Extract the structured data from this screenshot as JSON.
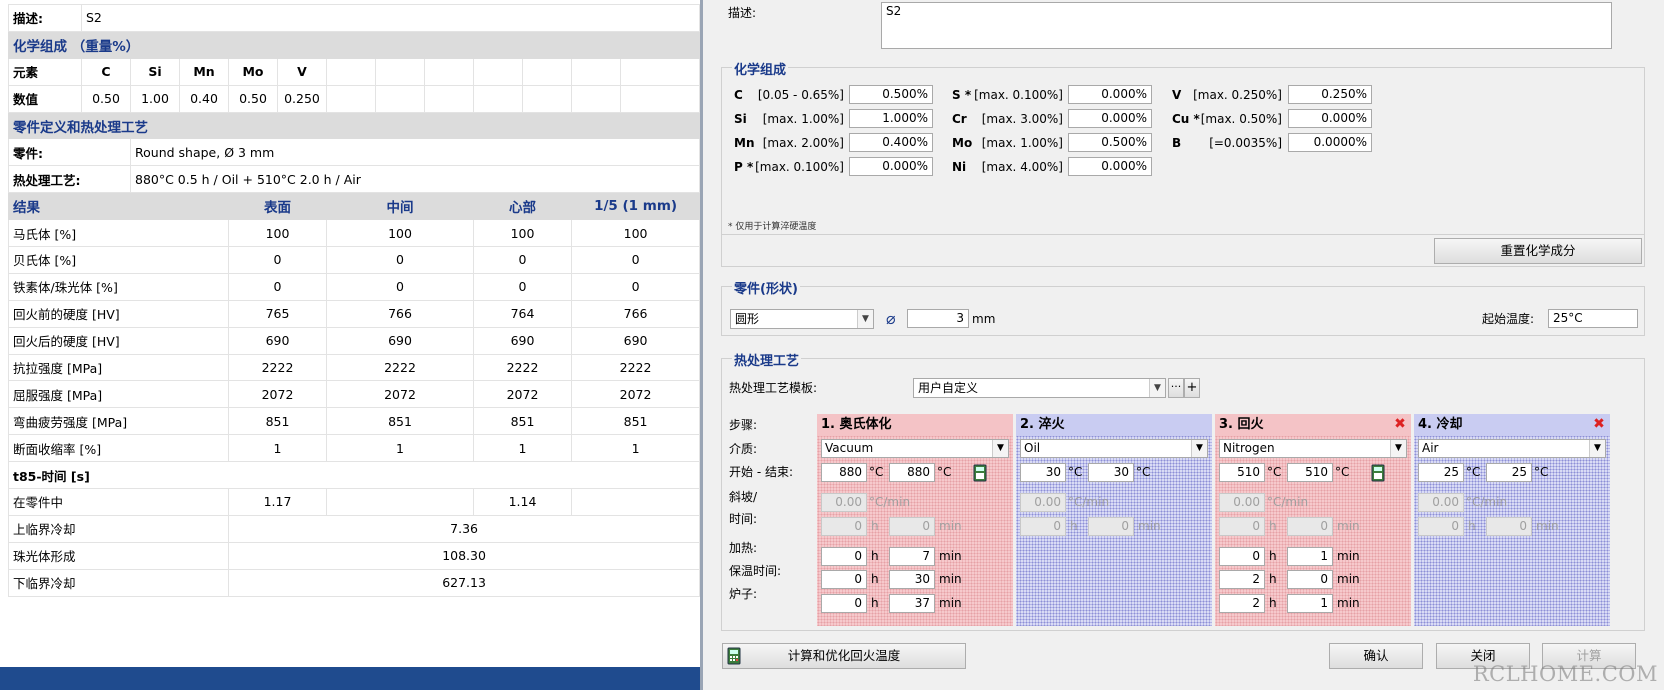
{
  "report": {
    "desc_label": "描述:",
    "desc_value": "S2",
    "chem_title": "化学组成 （重量%）",
    "element_label": "元素",
    "value_label": "数值",
    "elements": [
      "C",
      "Si",
      "Mn",
      "Mo",
      "V"
    ],
    "element_values": [
      "0.50",
      "1.00",
      "0.40",
      "0.50",
      "0.250"
    ],
    "part_title": "零件定义和热处理工艺",
    "part_label": "零件:",
    "part_value": "Round shape, Ø 3 mm",
    "ht_label": "热处理工艺:",
    "ht_value": "880°C 0.5 h / Oil + 510°C 2.0 h / Air",
    "results_header": [
      "结果",
      "表面",
      "中间",
      "心部",
      "1/5 (1 mm)"
    ],
    "results": [
      {
        "label": "马氏体 [%]",
        "values": [
          "100",
          "100",
          "100",
          "100"
        ]
      },
      {
        "label": "贝氏体 [%]",
        "values": [
          "0",
          "0",
          "0",
          "0"
        ]
      },
      {
        "label": "铁素体/珠光体 [%]",
        "values": [
          "0",
          "0",
          "0",
          "0"
        ]
      },
      {
        "label": "回火前的硬度 [HV]",
        "values": [
          "765",
          "766",
          "764",
          "766"
        ]
      },
      {
        "label": "回火后的硬度 [HV]",
        "values": [
          "690",
          "690",
          "690",
          "690"
        ]
      },
      {
        "label": "抗拉强度 [MPa]",
        "values": [
          "2222",
          "2222",
          "2222",
          "2222"
        ]
      },
      {
        "label": "屈服强度 [MPa]",
        "values": [
          "2072",
          "2072",
          "2072",
          "2072"
        ]
      },
      {
        "label": "弯曲疲劳强度 [MPa]",
        "values": [
          "851",
          "851",
          "851",
          "851"
        ]
      },
      {
        "label": "断面收缩率 [%]",
        "values": [
          "1",
          "1",
          "1",
          "1"
        ]
      }
    ],
    "t85_label": "t85-时间 [s]",
    "in_part_label": "在零件中",
    "in_part_values": [
      "1.17",
      "1.14"
    ],
    "upper_label": "上临界冷却",
    "upper_value": "7.36",
    "pearlite_label": "珠光体形成",
    "pearlite_value": "108.30",
    "lower_label": "下临界冷却",
    "lower_value": "627.13"
  },
  "dialog": {
    "desc_label": "描述:",
    "desc_value": "S2",
    "chem_title": "化学组成",
    "chem": [
      {
        "el": "C",
        "range": "[0.05 - 0.65%]",
        "value": "0.500%"
      },
      {
        "el": "Si",
        "range": "[max. 1.00%]",
        "value": "1.000%"
      },
      {
        "el": "Mn",
        "range": "[max. 2.00%]",
        "value": "0.400%"
      },
      {
        "el": "P *",
        "range": "[max. 0.100%]",
        "value": "0.000%"
      },
      {
        "el": "S *",
        "range": "[max. 0.100%]",
        "value": "0.000%"
      },
      {
        "el": "Cr",
        "range": "[max. 3.00%]",
        "value": "0.000%"
      },
      {
        "el": "Mo",
        "range": "[max. 1.00%]",
        "value": "0.500%"
      },
      {
        "el": "Ni",
        "range": "[max. 4.00%]",
        "value": "0.000%"
      },
      {
        "el": "V",
        "range": "[max. 0.250%]",
        "value": "0.250%"
      },
      {
        "el": "Cu *",
        "range": "[max. 0.50%]",
        "value": "0.000%"
      },
      {
        "el": "B",
        "range": "[=0.0035%]",
        "value": "0.0000%"
      }
    ],
    "footnote": "* 仅用于计算淬硬温度",
    "reset_button": "重置化学成分",
    "part_title": "零件(形状)",
    "shape": "圆形",
    "diameter": "3",
    "diameter_unit": "mm",
    "start_temp_label": "起始温度:",
    "start_temp": "25°C",
    "ht_title": "热处理工艺",
    "template_label": "热处理工艺模板:",
    "template_value": "用户自定义",
    "row_labels": [
      "步骤:",
      "介质:",
      "开始 - 结束:",
      "斜坡/",
      "时间:",
      "加热:",
      "保温时间:",
      "炉子:"
    ],
    "stages": [
      {
        "title": "1. 奥氏体化",
        "medium": "Vacuum",
        "start": "880",
        "end": "880",
        "ramp": "0.00",
        "rh": "0",
        "rm": "0",
        "heat_h": "0",
        "heat_m": "7",
        "hold_h": "0",
        "hold_m": "30",
        "furn_h": "0",
        "furn_m": "37"
      },
      {
        "title": "2. 淬火",
        "medium": "Oil",
        "start": "30",
        "end": "30",
        "ramp": "0.00",
        "rh": "0",
        "rm": "0"
      },
      {
        "title": "3. 回火",
        "medium": "Nitrogen",
        "start": "510",
        "end": "510",
        "ramp": "0.00",
        "rh": "0",
        "rm": "0",
        "heat_h": "0",
        "heat_m": "1",
        "hold_h": "2",
        "hold_m": "0",
        "furn_h": "2",
        "furn_m": "1"
      },
      {
        "title": "4. 冷却",
        "medium": "Air",
        "start": "25",
        "end": "25",
        "ramp": "0.00",
        "rh": "0",
        "rm": "0"
      }
    ],
    "unit_c": "°C",
    "unit_cmin": "°C/min",
    "unit_h": "h",
    "unit_min": "min",
    "calc_opt_button": "计算和优化回火温度",
    "ok_button": "确认",
    "close_button": "关闭",
    "calc_button": "计算"
  },
  "watermark": "RCLHOME.COM",
  "colors": {
    "section_blue": "#1a3a8a",
    "austenitize_pink": "#f6c9cc",
    "quench_blue": "#d9dbf5",
    "bottom_bar": "#1f4b8e"
  }
}
